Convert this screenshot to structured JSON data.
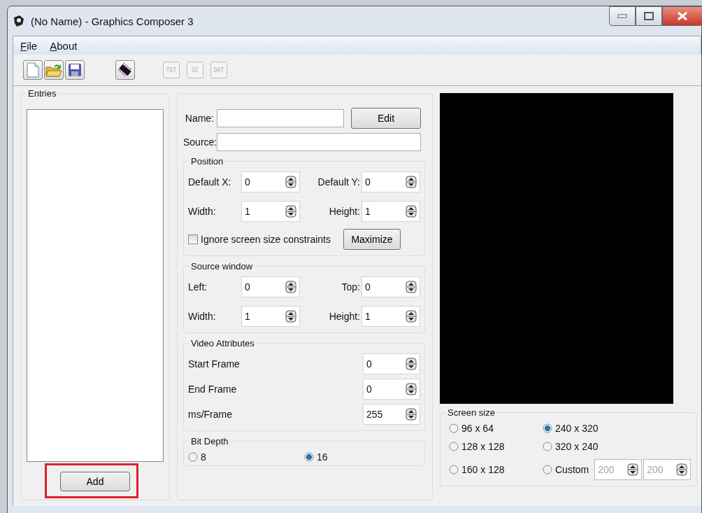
{
  "window": {
    "title": "(No Name) - Graphics Composer 3"
  },
  "menu": [
    {
      "label": "File"
    },
    {
      "label": "About"
    }
  ],
  "toolbar": [
    {
      "kind": "new",
      "disabled": false
    },
    {
      "kind": "open",
      "disabled": false
    },
    {
      "kind": "save",
      "disabled": false
    },
    {
      "kind": "chip",
      "disabled": false
    },
    {
      "kind": "text",
      "label": "TXT",
      "disabled": true
    },
    {
      "kind": "text",
      "label": "GC",
      "disabled": true
    },
    {
      "kind": "text",
      "label": "DAT",
      "disabled": true
    }
  ],
  "entries": {
    "title": "Entries",
    "add_button": "Add",
    "highlighted": true
  },
  "name": {
    "label": "Name:",
    "button": "Edit"
  },
  "source": {
    "label": "Source:"
  },
  "position": {
    "title": "Position",
    "fields": [
      {
        "label": "Default X:",
        "value": "0"
      },
      {
        "label": "Default Y:",
        "value": "0"
      },
      {
        "label": "Width:",
        "value": "1"
      },
      {
        "label": "Height:",
        "value": "1"
      }
    ],
    "checkbox": {
      "label": "Ignore screen size constraints",
      "checked": false
    },
    "button": "Maximize"
  },
  "source_window": {
    "title": "Source window",
    "fields": [
      {
        "label": "Left:",
        "value": "0"
      },
      {
        "label": "Top:",
        "value": "0"
      },
      {
        "label": "Width:",
        "value": "1"
      },
      {
        "label": "Height:",
        "value": "1"
      }
    ]
  },
  "video": {
    "title": "Video Attributes",
    "fields": [
      {
        "label": "Start Frame",
        "value": "0"
      },
      {
        "label": "End Frame",
        "value": "0"
      },
      {
        "label": "ms/Frame",
        "value": "255"
      }
    ]
  },
  "bit_depth": {
    "title": "Bit Depth",
    "options": [
      {
        "label": "8",
        "selected": false
      },
      {
        "label": "16",
        "selected": true
      }
    ]
  },
  "screen_size": {
    "title": "Screen size",
    "options": [
      {
        "label": "96 x 64",
        "selected": false
      },
      {
        "label": "240 x 320",
        "selected": true
      },
      {
        "label": "128 x 128",
        "selected": false
      },
      {
        "label": "320 x 240",
        "selected": false
      },
      {
        "label": "160 x 128",
        "selected": false
      },
      {
        "label": "Custom",
        "selected": false
      }
    ],
    "custom": [
      {
        "value": "200",
        "disabled": true
      },
      {
        "value": "200",
        "disabled": true
      }
    ]
  }
}
